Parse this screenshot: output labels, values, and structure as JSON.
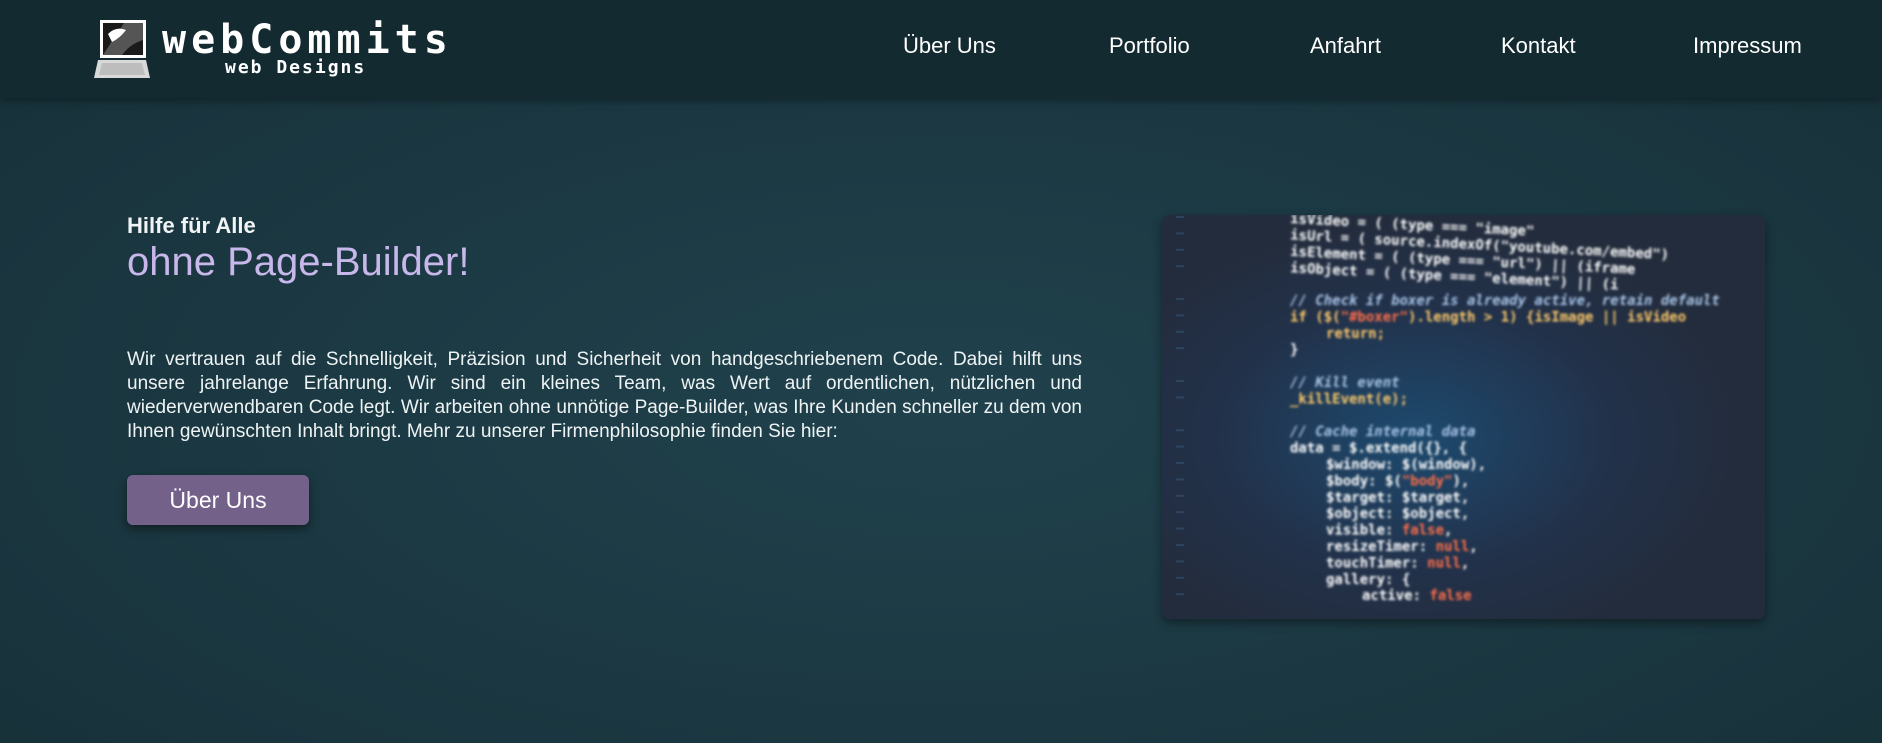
{
  "brand": {
    "title": "webCommits",
    "subtitle": "web Designs"
  },
  "nav": {
    "items": [
      {
        "label": "Über Uns"
      },
      {
        "label": "Portfolio"
      },
      {
        "label": "Anfahrt"
      },
      {
        "label": "Kontakt"
      },
      {
        "label": "Impressum"
      }
    ]
  },
  "hero": {
    "kicker": "Hilfe für Alle",
    "title": "ohne Page-Builder!",
    "text": "Wir vertrauen auf die Schnelligkeit, Präzision und Sicherheit von handgeschriebenem Code. Dabei hilft uns unsere jahrelange Erfahrung. Wir sind ein kleines Team, was Wert auf ordentlichen, nützlichen und wiederverwendbaren Code legt. Wir arbeiten ohne unnötige Page-Builder, was Ihre Kunden schneller zu dem von Ihnen gewünschten Inhalt bringt. Mehr zu unserer Firmenphilosophie finden Sie hier:",
    "button_label": "Über Uns"
  },
  "code_image": {
    "lines": [
      "isVideo = ( (type === \"image\"",
      "isUrl    = ( source.indexOf(\"youtube.com/embed\")",
      "isElement = ( (type === \"url\") || (iframe",
      "isObject  = ( (type === \"element\") || (i",
      "",
      "// Check if boxer is already active, retain default",
      "if ($(\"#boxer\").length > 1) {isImage || isVideo",
      "    return;",
      "}",
      "",
      "// Kill event",
      "_killEvent(e);",
      "",
      "// Cache internal data",
      "data = $.extend({}, {",
      "    $window: $(window),",
      "    $body: $(\"body\"),",
      "    $target: $target,",
      "    $object: $object,",
      "    visible: false,",
      "    resizeTimer: null,",
      "    touchTimer: null,",
      "    gallery: {",
      "        active: false"
    ]
  },
  "colors": {
    "page_bg": "#1b3842",
    "navbar_bg": "#132a31",
    "accent_title": "#c7b7ea",
    "button_bg": "#736189"
  }
}
